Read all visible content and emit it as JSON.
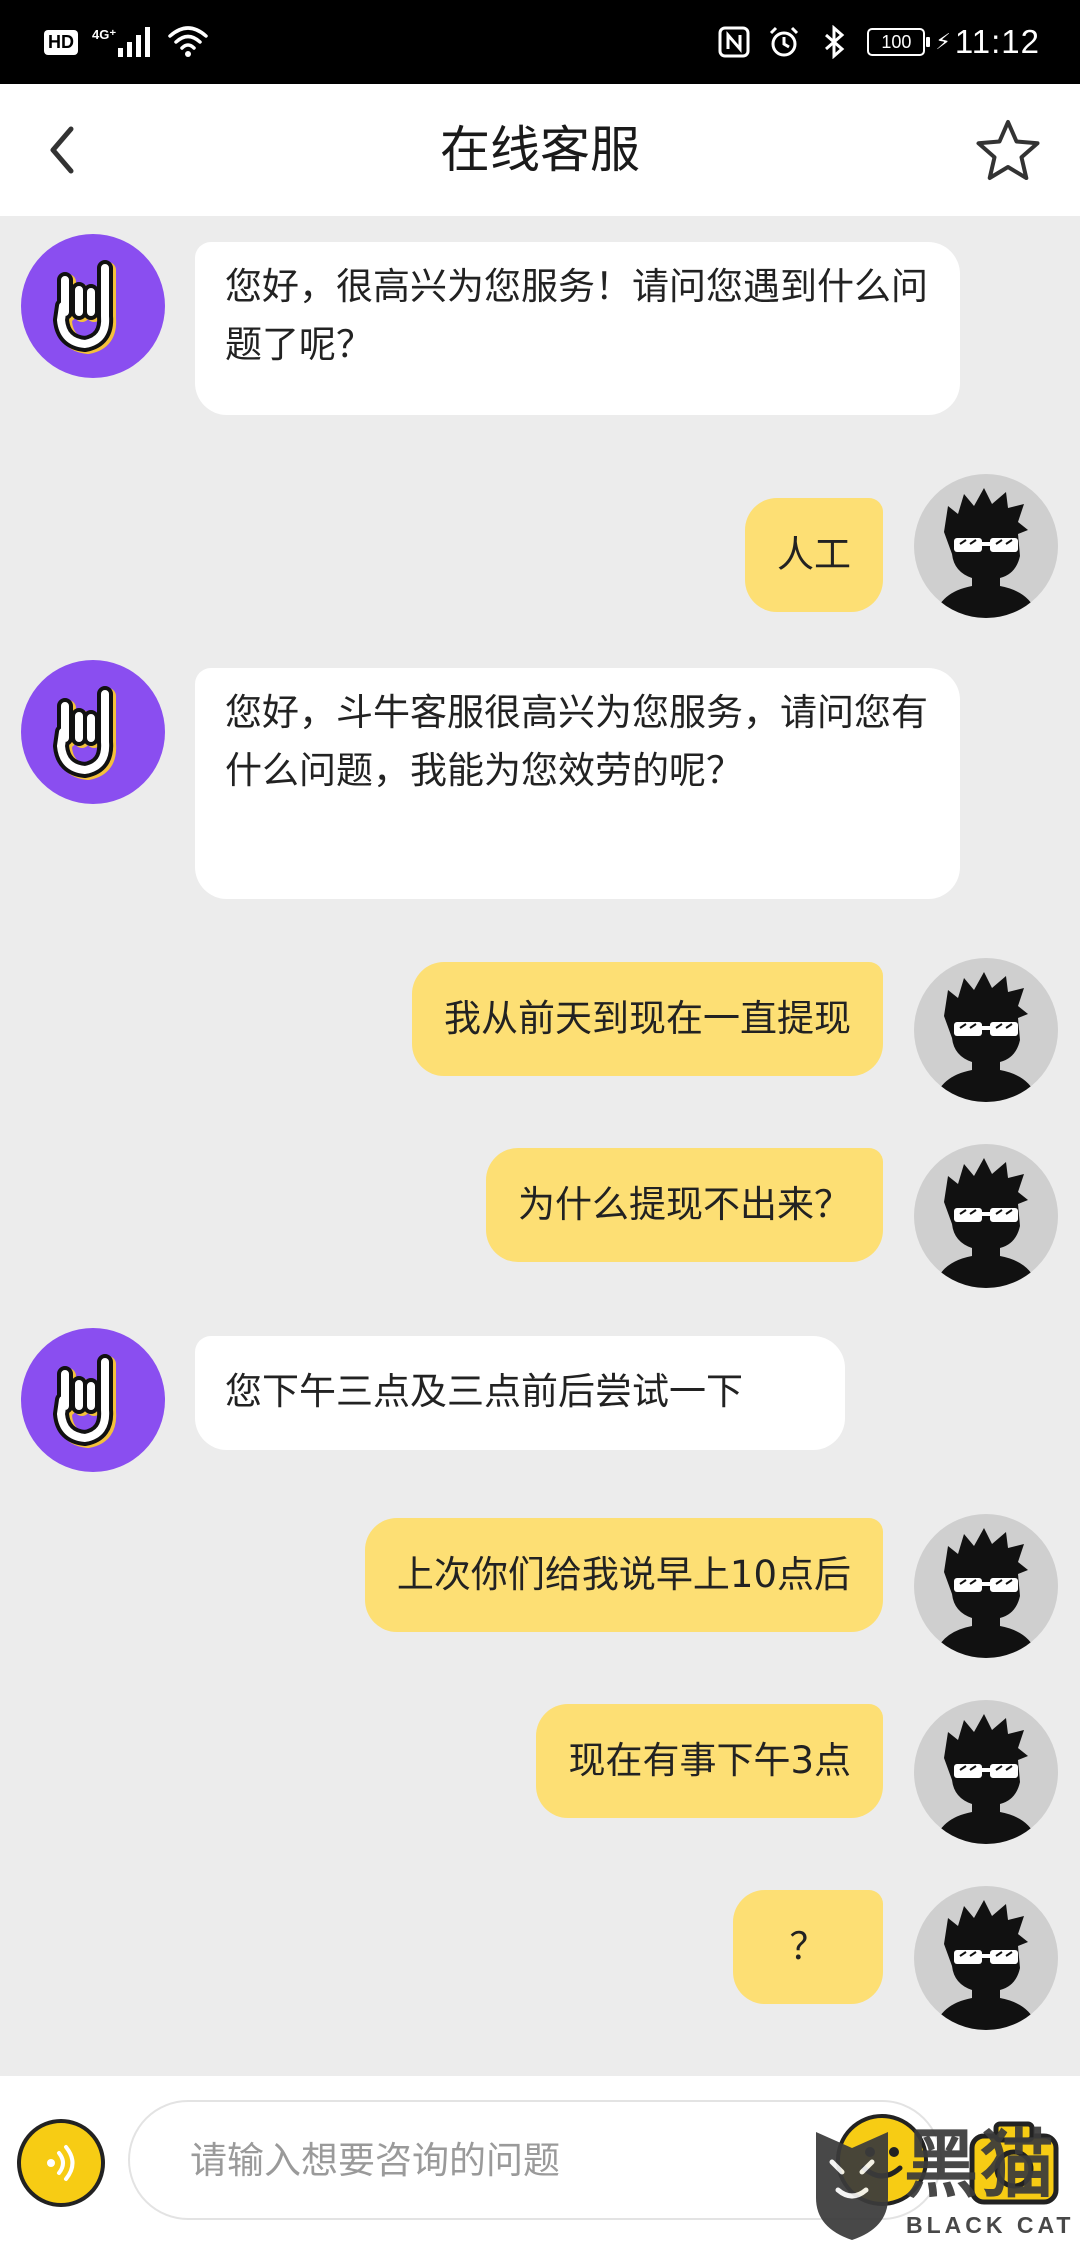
{
  "status_bar": {
    "hd_label": "HD",
    "network_label": "4G⁺",
    "battery": "100",
    "time": "11:12",
    "icons": [
      "signal-icon",
      "wifi-icon",
      "nfc-icon",
      "alarm-icon",
      "bluetooth-icon",
      "battery-icon",
      "charging-icon"
    ]
  },
  "header": {
    "title": "在线客服",
    "back_icon": "chevron-left-icon",
    "favorite_icon": "star-icon"
  },
  "messages": [
    {
      "from": "agent",
      "text": "您好，很高兴为您服务！请问您遇到什么问题了呢？"
    },
    {
      "from": "user",
      "text": "人工"
    },
    {
      "from": "agent",
      "text": "您好，斗牛客服很高兴为您服务，请问您有什么问题，我能为您效劳的呢？"
    },
    {
      "from": "user",
      "text": "我从前天到现在一直提现"
    },
    {
      "from": "user",
      "text": "为什么提现不出来？"
    },
    {
      "from": "agent",
      "text": "您下午三点及三点前后尝试一下"
    },
    {
      "from": "user",
      "text": "上次你们给我说早上10点后"
    },
    {
      "from": "user",
      "text": "现在有事下午3点"
    },
    {
      "from": "user",
      "text": "？"
    }
  ],
  "input_bar": {
    "placeholder": "请输入想要咨询的问题",
    "value": "",
    "voice_icon": "voice-icon",
    "emoji_icon": "emoji-icon",
    "more_icon": "camera-icon"
  },
  "watermark": {
    "text": "黑猫",
    "subtext": "BLACK CAT"
  },
  "colors": {
    "status_bar": "#000000",
    "header": "#ffffff",
    "chat_background": "#ececec",
    "agent_bubble": "#ffffff",
    "user_bubble": "#fddf74",
    "agent_avatar": "#8a4ef0",
    "user_avatar": "#cfcfcf",
    "accent_yellow": "#f7cc14"
  }
}
